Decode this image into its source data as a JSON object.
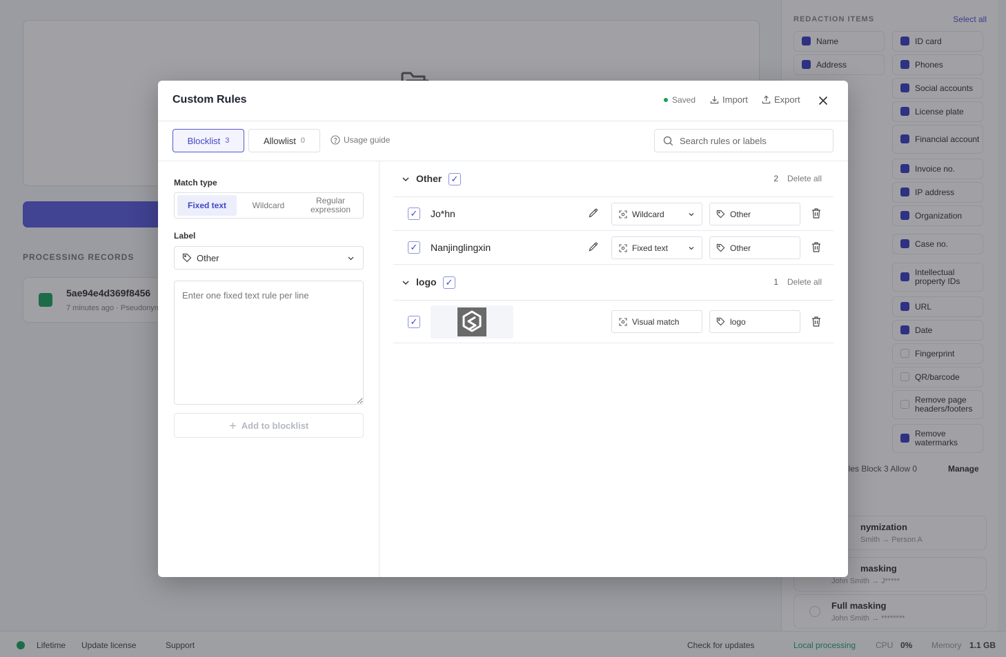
{
  "background": {
    "processing_records": "PROCESSING RECORDS",
    "record_name": "5ae94e4d369f8456",
    "record_meta": "7 minutes ago · Pseudonym",
    "redaction_items_title": "REDACTION ITEMS",
    "select_all": "Select all",
    "items_left": [
      "Name",
      "Address"
    ],
    "items_right": [
      "ID card",
      "Phones",
      "Social accounts",
      "License plate",
      "Financial account",
      "Invoice no.",
      "IP address",
      "Organization",
      "Case no.",
      "Intellectual property IDs",
      "URL",
      "Date",
      "Fingerprint",
      "QR/barcode",
      "Remove page headers/footers",
      "Remove watermarks"
    ],
    "rules_line": "ules   Block 3   Allow 0",
    "manage": "Manage",
    "modes": [
      {
        "title": "nymization",
        "sub": "Smith → Person A"
      },
      {
        "title": "masking",
        "sub": "John Smith → J*****"
      },
      {
        "title": "Full masking",
        "sub": "John Smith → ********"
      }
    ]
  },
  "statusbar": {
    "license": "Lifetime",
    "update_license": "Update license",
    "support": "Support",
    "check_updates": "Check for updates",
    "local_processing": "Local processing",
    "cpu_label": "CPU",
    "cpu_value": "0%",
    "memory_label": "Memory",
    "memory_value": "1.1 GB"
  },
  "modal": {
    "title": "Custom Rules",
    "saved": "Saved",
    "import": "Import",
    "export": "Export",
    "tabs": [
      {
        "label": "Blocklist",
        "count": "3"
      },
      {
        "label": "Allowlist",
        "count": "0"
      }
    ],
    "usage_guide": "Usage guide",
    "search_placeholder": "Search rules or labels",
    "left": {
      "match_type_label": "Match type",
      "match_types": [
        "Fixed text",
        "Wildcard",
        "Regular expression"
      ],
      "label_label": "Label",
      "label_value": "Other",
      "textarea_placeholder": "Enter one fixed text rule per line",
      "add_button": "Add to blocklist"
    },
    "groups": [
      {
        "name": "Other",
        "count": "2",
        "delete_all": "Delete all",
        "rules": [
          {
            "text": "Jo*hn",
            "type": "Wildcard",
            "label": "Other"
          },
          {
            "text": "Nanjinglingxin",
            "type": "Fixed text",
            "label": "Other"
          }
        ]
      },
      {
        "name": "logo",
        "count": "1",
        "delete_all": "Delete all",
        "rules": [
          {
            "type": "Visual match",
            "label": "logo"
          }
        ]
      }
    ]
  },
  "colors": {
    "accent": "#4245c6",
    "saved_dot": "#18a058",
    "overlay": "rgba(30,32,40,0.42)"
  }
}
